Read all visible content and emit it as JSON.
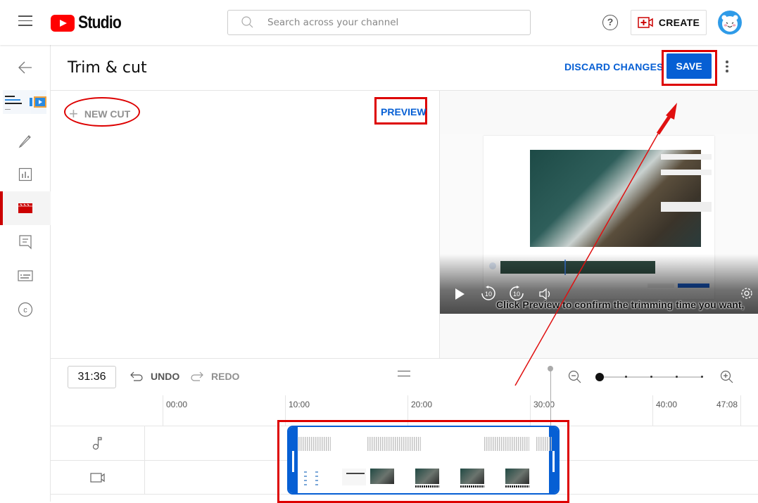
{
  "topbar": {
    "brand": "Studio",
    "search_placeholder": "Search across your channel",
    "create_label": "CREATE",
    "help_glyph": "?"
  },
  "sidebar": {
    "items": [
      {
        "name": "back",
        "icon": "arrow-left-icon"
      },
      {
        "name": "video-thumbnail",
        "thumbnail_text": [
          "HOW TO",
          "TRIM VIDEOS",
          "ON WINDOWS"
        ]
      },
      {
        "name": "details",
        "icon": "pencil-icon"
      },
      {
        "name": "analytics",
        "icon": "bar-chart-icon"
      },
      {
        "name": "editor",
        "icon": "clapperboard-icon",
        "active": true
      },
      {
        "name": "comments",
        "icon": "comment-icon"
      },
      {
        "name": "subtitles",
        "icon": "subtitles-icon"
      },
      {
        "name": "copyright",
        "icon": "copyright-icon"
      }
    ]
  },
  "header": {
    "title": "Trim & cut",
    "discard_label": "DISCARD CHANGES",
    "save_label": "SAVE"
  },
  "cuts": {
    "new_cut_label": "NEW CUT",
    "preview_label": "PREVIEW"
  },
  "player": {
    "caption": "Click Preview to confirm the trimming time you want,",
    "rewind_label": "10",
    "forward_label": "10"
  },
  "timeline": {
    "current_time": "31:36",
    "undo_label": "UNDO",
    "redo_label": "REDO",
    "ruler_ticks": [
      "00:00",
      "10:00",
      "20:00",
      "30:00",
      "40:00",
      "47:08"
    ],
    "zoom_level_steps": 5,
    "zoom_level_current": 0,
    "tracks": [
      "audio",
      "video"
    ]
  },
  "colors": {
    "accent": "#065fd4",
    "brand_red": "#ff0000",
    "annotation_red": "#dd0000"
  }
}
